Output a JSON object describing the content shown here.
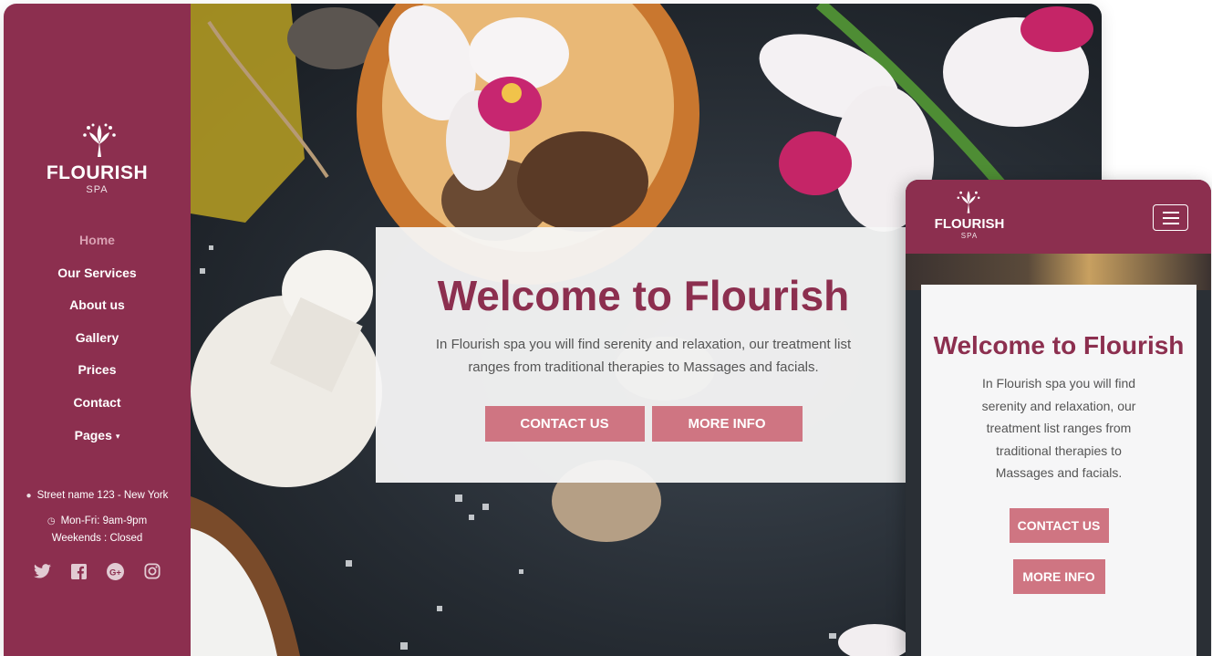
{
  "sidebar": {
    "brand": "FLOURISH",
    "brand_sub": "SPA",
    "nav": [
      "Home",
      "Our Services",
      "About us",
      "Gallery",
      "Prices",
      "Contact",
      "Pages"
    ],
    "address": "Street name 123 - New York",
    "hours": "Mon-Fri: 9am-9pm",
    "weekends": "Weekends : Closed",
    "social_icons": [
      "twitter-icon",
      "facebook-icon",
      "google-plus-icon",
      "instagram-icon"
    ]
  },
  "hero": {
    "title": "Welcome to Flourish",
    "text": "In Flourish spa you will find serenity and relaxation, our treatment list ranges from traditional therapies to Massages and facials.",
    "contact_button": "CONTACT US",
    "more_button": "MORE INFO"
  },
  "mobile": {
    "brand": "FLOURISH",
    "brand_sub": "SPA",
    "title": "Welcome to Flourish",
    "text": "In Flourish spa you will find serenity and relaxation, our treatment list ranges from traditional therapies to Massages and facials.",
    "contact_button": "CONTACT US",
    "more_button": "MORE INFO"
  },
  "colors": {
    "brand": "#8c2f4f",
    "button": "#cf7582",
    "active_nav": "#d9a0b2"
  }
}
